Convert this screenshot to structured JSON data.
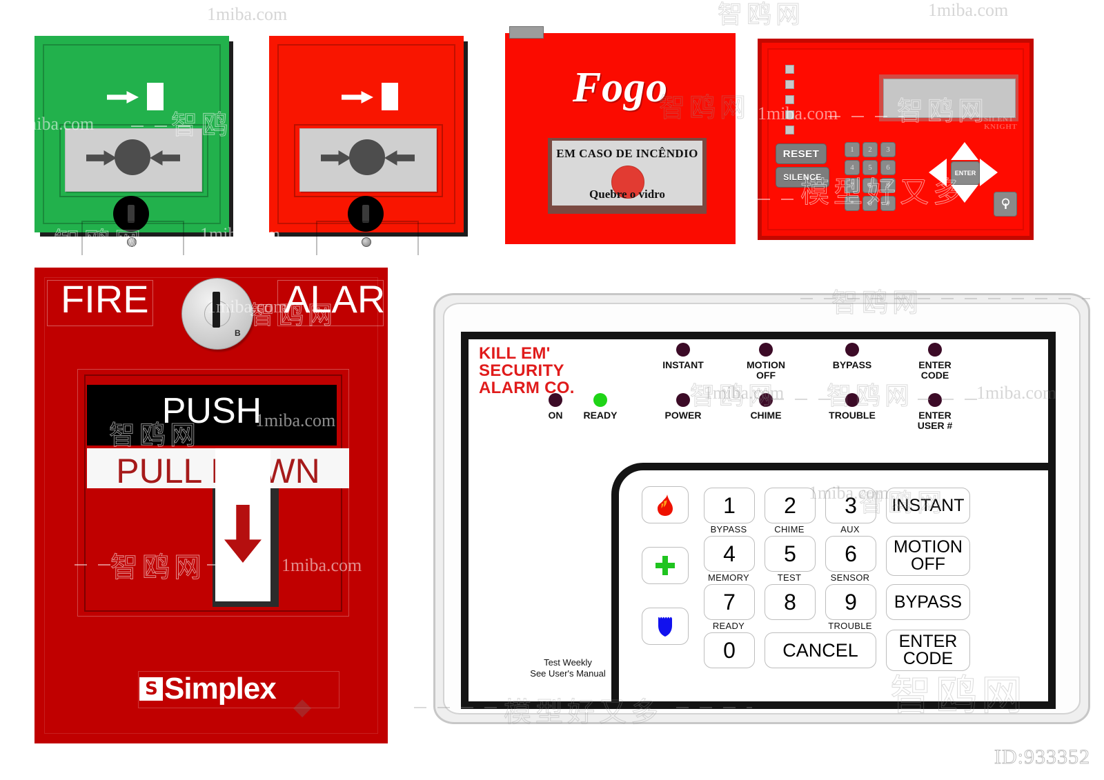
{
  "page": {
    "background": "#ffffff",
    "id_watermark": "ID:933352"
  },
  "watermarks": {
    "site": "1miba.com",
    "cn_brand": "智鸥网",
    "cn_tagline": "模型好又多"
  },
  "call_point_green": {
    "name": "green-call-point",
    "body_color": "#22b14c",
    "glass_color": "#cfcfcf",
    "top_arrow_icon": "arrow-right-icon",
    "top_bar_icon": "white-bar-icon",
    "center_button_icon": "press-dot-icon",
    "left_arrow_icon": "arrow-right-icon",
    "right_arrow_icon": "arrow-left-icon",
    "keyhole_icon": "keyhole-icon",
    "screw_icon": "screw-icon"
  },
  "call_point_red": {
    "name": "red-call-point",
    "body_color": "#f91500",
    "glass_color": "#cfcfcf",
    "top_arrow_icon": "arrow-right-icon",
    "top_bar_icon": "white-bar-icon",
    "center_button_icon": "press-dot-icon",
    "left_arrow_icon": "arrow-right-icon",
    "right_arrow_icon": "arrow-left-icon",
    "keyhole_icon": "keyhole-icon",
    "screw_icon": "screw-icon"
  },
  "fogo_panel": {
    "title": "Fogo",
    "instruction_line1": "EM CASO DE INCÊNDIO",
    "instruction_line2": "Quebre o vidro",
    "button_icon": "break-glass-button-icon",
    "body_color": "#fb0b00",
    "glass_color": "#d9d9d9",
    "button_color": "#e23b32"
  },
  "facp": {
    "brand": "SILENT KNIGHT",
    "brand_line1": "SILENT",
    "brand_line2": "KNIGHT",
    "body_color": "#fb0b00",
    "display_placeholder": "",
    "status_leds": [
      "led-1",
      "led-2",
      "led-3",
      "led-4",
      "led-5"
    ],
    "buttons": [
      {
        "label": "RESET",
        "name": "reset-button"
      },
      {
        "label": "SILENCE",
        "name": "silence-button"
      }
    ],
    "keypad": [
      [
        "1",
        "2",
        "3"
      ],
      [
        "4",
        "5",
        "6"
      ],
      [
        "7",
        "8",
        "9"
      ],
      [
        "*",
        "0",
        "#"
      ]
    ],
    "nav": {
      "up": "arrow-up-icon",
      "down": "arrow-down-icon",
      "left": "arrow-left-icon",
      "right": "arrow-right-icon",
      "enter": "ENTER"
    },
    "keylock_icon": "key-lock-icon"
  },
  "simplex": {
    "word_left": "FIRE",
    "word_right": "ALARM",
    "key_cylinder_label": "B",
    "push_label": "PUSH",
    "pull_label": "PULL DOWN",
    "arrow_icon": "arrow-down-icon",
    "brand": "Simplex",
    "brand_mark": "S",
    "body_color": "#c00000",
    "pull_text_color": "#a61a1a"
  },
  "security_panel": {
    "brand_line1": "KILL EM'",
    "brand_line2": "SECURITY",
    "brand_line3": "ALARM CO.",
    "brand_color": "#e01b1b",
    "leds_row1": [
      {
        "label": "INSTANT",
        "state": "off",
        "color": "#3c0b27"
      },
      {
        "label": "MOTION\nOFF",
        "state": "off",
        "color": "#3c0b27"
      },
      {
        "label": "BYPASS",
        "state": "off",
        "color": "#3c0b27"
      },
      {
        "label": "ENTER\nCODE",
        "state": "off",
        "color": "#3c0b27"
      }
    ],
    "leds_row2": [
      {
        "label": "ON",
        "state": "off",
        "color": "#3c0b27"
      },
      {
        "label": "READY",
        "state": "on",
        "color": "#1fd417"
      },
      {
        "label": "POWER",
        "state": "off",
        "color": "#3c0b27"
      },
      {
        "label": "CHIME",
        "state": "off",
        "color": "#3c0b27"
      },
      {
        "label": "TROUBLE",
        "state": "off",
        "color": "#3c0b27"
      },
      {
        "label": "ENTER\nUSER #",
        "state": "off",
        "color": "#3c0b27"
      }
    ],
    "panic_keys": [
      {
        "icon": "fire-icon",
        "name": "fire-panic-key",
        "color": "#ee1100"
      },
      {
        "icon": "medical-cross-icon",
        "name": "medical-panic-key",
        "color": "#1fc41f"
      },
      {
        "icon": "police-badge-icon",
        "name": "police-panic-key",
        "color": "#1111ee"
      }
    ],
    "number_keys": [
      {
        "digit": "1",
        "sub": "BYPASS"
      },
      {
        "digit": "2",
        "sub": "CHIME"
      },
      {
        "digit": "3",
        "sub": "AUX"
      },
      {
        "digit": "4",
        "sub": "MEMORY"
      },
      {
        "digit": "5",
        "sub": "TEST"
      },
      {
        "digit": "6",
        "sub": "SENSOR"
      },
      {
        "digit": "7",
        "sub": "READY"
      },
      {
        "digit": "8",
        "sub": ""
      },
      {
        "digit": "9",
        "sub": "TROUBLE"
      },
      {
        "digit": "0",
        "sub": ""
      }
    ],
    "cancel_key": "CANCEL",
    "function_keys": [
      {
        "label": "INSTANT",
        "name": "instant-key"
      },
      {
        "label": "MOTION\nOFF",
        "name": "motion-off-key"
      },
      {
        "label": "BYPASS",
        "name": "bypass-key"
      },
      {
        "label": "ENTER\nCODE",
        "name": "enter-code-key"
      }
    ],
    "footer_note": "Test Weekly\nSee User's Manual"
  }
}
